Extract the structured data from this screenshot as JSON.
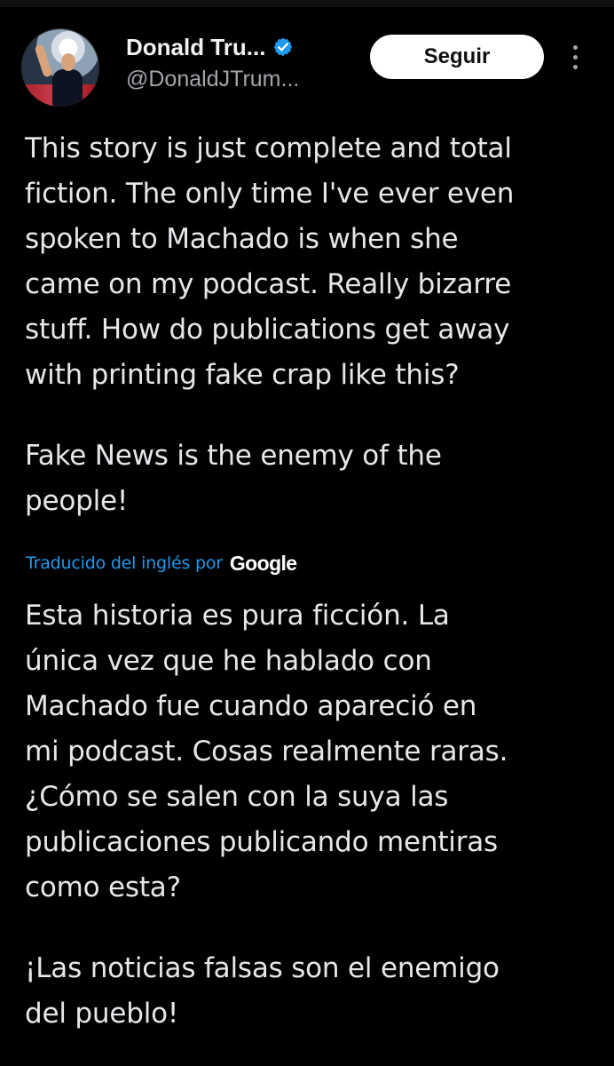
{
  "tweet": {
    "author": {
      "display_name": "Donald Tru...",
      "handle": "@DonaldJTrum...",
      "avatar_icon": "profile-photo",
      "verified_icon": "verified-badge-icon",
      "verified_color": "#1d9bf0"
    },
    "actions": {
      "follow_label": "Seguir",
      "more_icon": "vertical-more-icon"
    },
    "original_text": {
      "paragraph_1": "This story is just complete and total\nfiction. The only time I've ever even\nspoken to Machado is when she\ncame on my podcast. Really bizarre\nstuff. How do publications get away\nwith printing fake crap like this?",
      "paragraph_2": "Fake News is the enemy of the\npeople!"
    },
    "translation": {
      "label": "Traducido del inglés por",
      "provider": "Google",
      "paragraph_1": "Esta historia es pura ficción. La\núnica vez que he hablado con\nMachado fue cuando apareció en\nmi podcast. Cosas realmente raras.\n¿Cómo se salen con la suya las\npublicaciones publicando mentiras\ncomo esta?",
      "paragraph_2": "¡Las noticias falsas son el enemigo\ndel pueblo!"
    }
  },
  "colors": {
    "background": "#000000",
    "primary_text": "#e7e9ea",
    "secondary_text": "#a2a6ab",
    "link_blue": "#1d9bf0",
    "button_background": "#ffffff"
  }
}
